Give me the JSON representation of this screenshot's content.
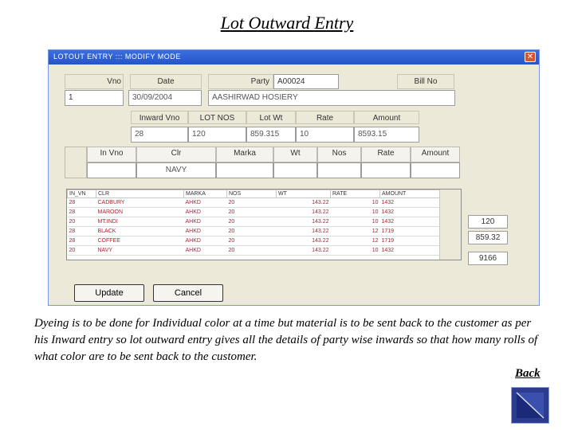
{
  "slide_title": "Lot Outward Entry",
  "window": {
    "title": "LOTOUT ENTRY  :::  MODIFY MODE",
    "close_glyph": "✕"
  },
  "header_fields": {
    "vno_label": "Vno",
    "vno_value": "1",
    "date_label": "Date",
    "date_value": "30/09/2004",
    "party_label": "Party",
    "party_code": "A00024",
    "party_name": "AASHIRWAD HOSIERY",
    "billno_label": "Bill No"
  },
  "summary_fields": {
    "inward_vno_label": "Inward Vno",
    "inward_vno_value": "28",
    "lot_nos_label": "LOT NOS",
    "lot_nos_value": "120",
    "lot_wt_label": "Lot Wt",
    "lot_wt_value": "859.315",
    "rate_label": "Rate",
    "rate_value": "10",
    "amount_label": "Amount",
    "amount_value": "8593.15"
  },
  "entry_fields": {
    "in_vno_label": "In Vno",
    "clr_label": "Clr",
    "clr_value": "NAVY",
    "marka_label": "Marka",
    "wt_label": "Wt",
    "nos_label": "Nos",
    "rate_label": "Rate",
    "amount_label": "Amount"
  },
  "grid": {
    "columns": [
      "IN_VN",
      "CLR",
      "MARKA",
      "NOS",
      "WT",
      "RATE",
      "AMOUNT"
    ],
    "rows": [
      [
        "28",
        "CADBURY",
        "AHKD",
        "20",
        "143.22",
        "10",
        "1432"
      ],
      [
        "28",
        "MAROON",
        "AHKD",
        "20",
        "143.22",
        "10",
        "1432"
      ],
      [
        "20",
        "MT.INDI",
        "AHKD",
        "20",
        "143.22",
        "10",
        "1432"
      ],
      [
        "28",
        "BLACK",
        "AHKD",
        "20",
        "143.22",
        "12",
        "1719"
      ],
      [
        "28",
        "COFFEE",
        "AHKD",
        "20",
        "143.22",
        "12",
        "1719"
      ],
      [
        "20",
        "NAVY",
        "AHKD",
        "20",
        "143.22",
        "10",
        "1432"
      ]
    ]
  },
  "totals": {
    "nos": "120",
    "wt": "859.32",
    "amount": "9166"
  },
  "buttons": {
    "update": "Update",
    "cancel": "Cancel"
  },
  "description": "Dyeing is to be done for Individual color at a time but material is to be sent back to the customer as per his Inward entry so lot outward entry gives all the details of party wise inwards so that how many rolls of what color are to be sent back to the customer.",
  "back_link": "Back"
}
